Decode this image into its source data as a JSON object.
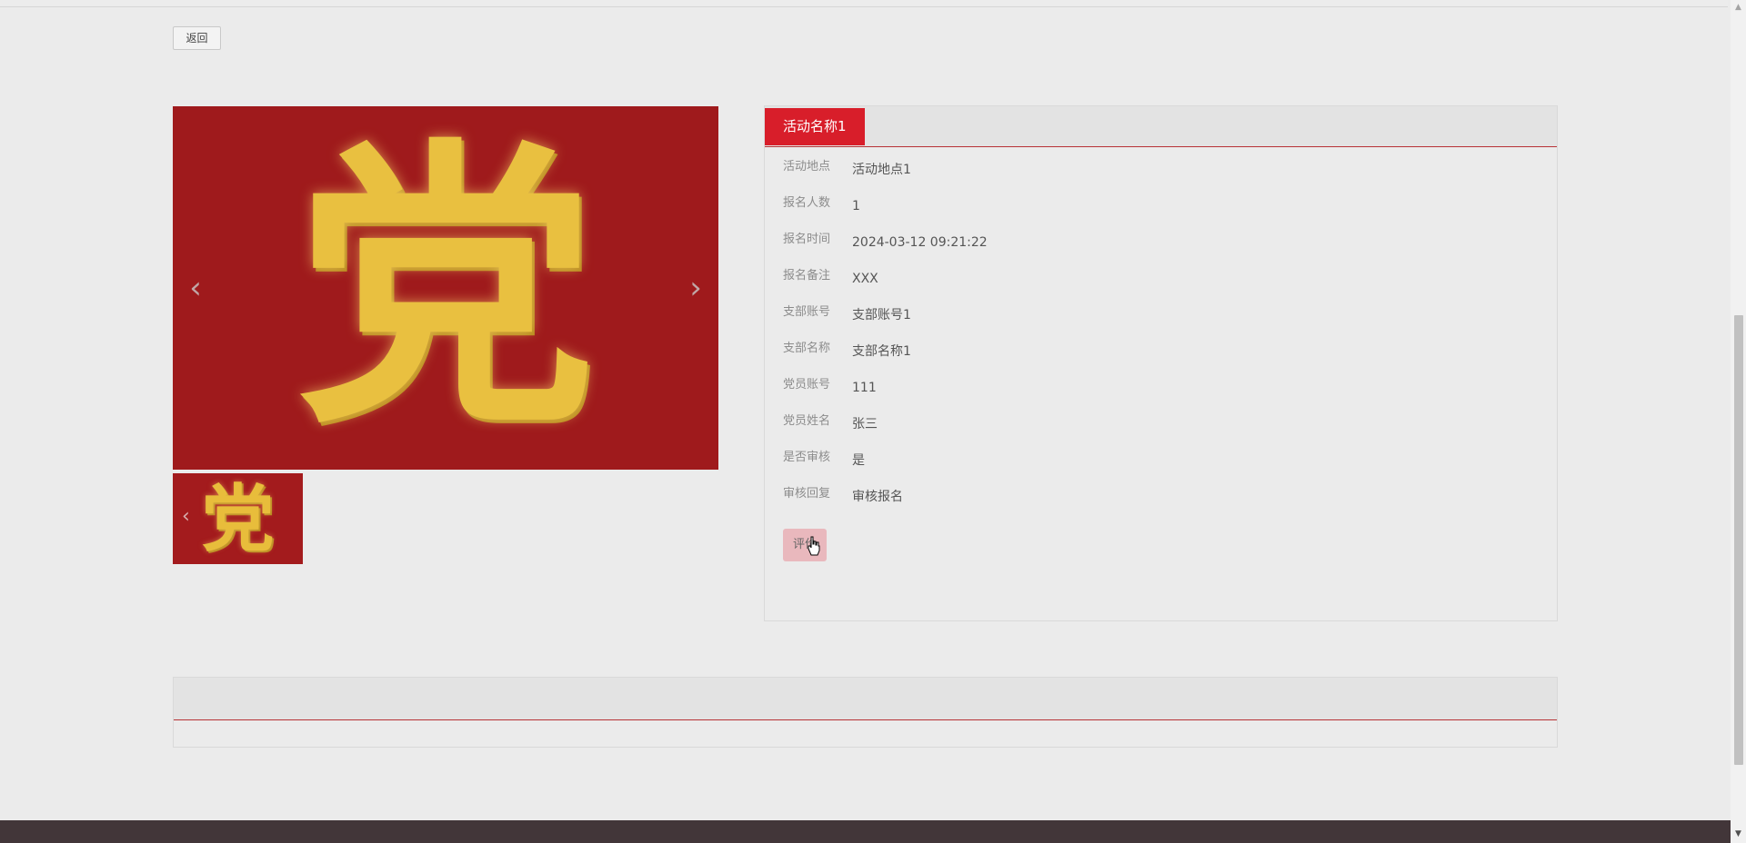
{
  "back_button": {
    "label": "返回"
  },
  "carousel": {
    "image_glyph": "党",
    "prev_icon": "‹",
    "next_icon": "›",
    "thumbnails": [
      {
        "glyph": "党",
        "prev_icon": "‹"
      }
    ]
  },
  "detail": {
    "title": "活动名称1",
    "fields": [
      {
        "label": "活动地点",
        "value": "活动地点1"
      },
      {
        "label": "报名人数",
        "value": "1"
      },
      {
        "label": "报名时间",
        "value": "2024-03-12 09:21:22"
      },
      {
        "label": "报名备注",
        "value": "XXX"
      },
      {
        "label": "支部账号",
        "value": "支部账号1"
      },
      {
        "label": "支部名称",
        "value": "支部名称1"
      },
      {
        "label": "党员账号",
        "value": "111"
      },
      {
        "label": "党员姓名",
        "value": "张三"
      },
      {
        "label": "是否审核",
        "value": "是"
      },
      {
        "label": "审核回复",
        "value": "审核报名"
      }
    ],
    "rate_button": "评价"
  },
  "scrollbar": {
    "up_icon": "▲",
    "down_icon": "▼"
  },
  "colors": {
    "accent": "#d81e2a",
    "banner_bg": "#9f1a1c",
    "gold": "#e9c040",
    "footer": "#423639",
    "page_bg": "#ebebeb"
  }
}
